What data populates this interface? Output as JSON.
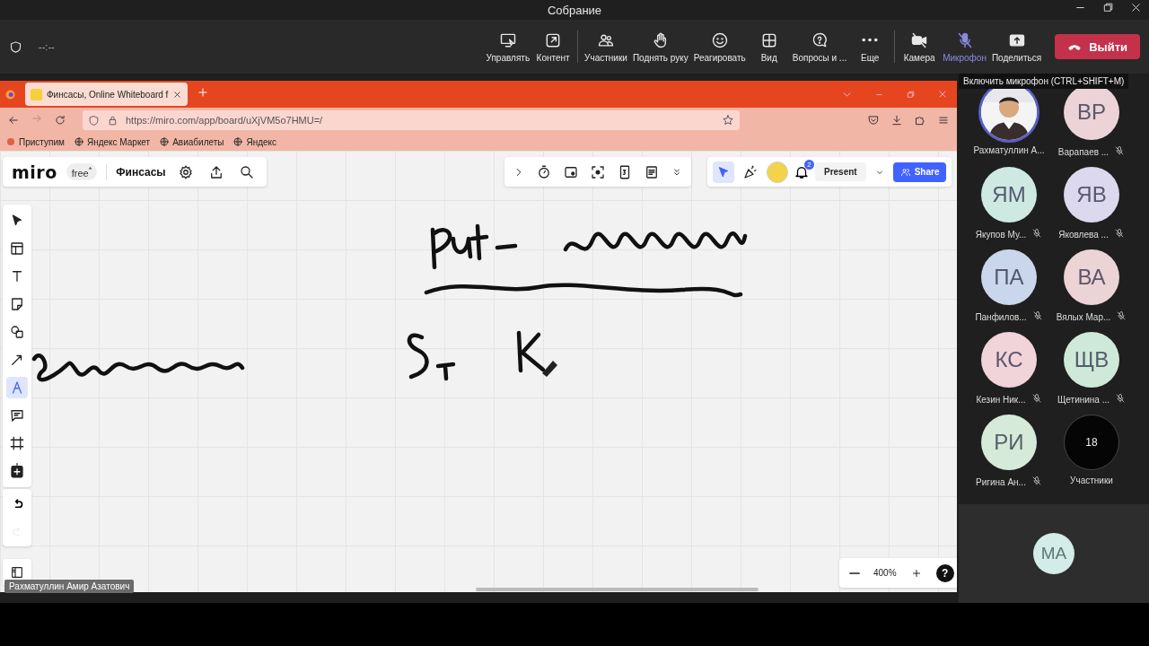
{
  "window": {
    "title": "Собрание"
  },
  "meeting_bar": {
    "timer": "--:--",
    "buttons": [
      {
        "label": "Управлять",
        "off": false
      },
      {
        "label": "Контент",
        "off": false
      },
      {
        "label": "Участники",
        "off": false
      },
      {
        "label": "Поднять руку",
        "off": false
      },
      {
        "label": "Реагировать",
        "off": false
      },
      {
        "label": "Вид",
        "off": false
      },
      {
        "label": "Вопросы и ...",
        "off": false
      },
      {
        "label": "Еще",
        "off": false
      },
      {
        "label": "Камера",
        "off": true
      },
      {
        "label": "Микрофон",
        "off": true
      },
      {
        "label": "Поделиться",
        "off": false
      }
    ],
    "leave": {
      "label": "Выйти"
    }
  },
  "tooltip": {
    "text": "Включить микрофон (CTRL+SHIFT+M)"
  },
  "browser": {
    "tab": {
      "title": "Финсасы, Online Whiteboard f",
      "selected": true
    },
    "url": "https://miro.com/app/board/uXjVM5o7HMU=/",
    "bookmarks": [
      "Приступим",
      "Яндекс Маркет",
      "Авиабилеты",
      "Яндекс"
    ]
  },
  "miro": {
    "logo": "miro",
    "plan": "free$^{*}$",
    "board_name": "Финсасы",
    "notification_count": "2",
    "present": "Present",
    "share": "Share",
    "zoom": "400%",
    "help": "?",
    "tools": [
      {
        "selected": false
      },
      {
        "selected": false
      },
      {
        "selected": false
      },
      {
        "selected": false
      },
      {
        "selected": false
      },
      {
        "selected": false
      },
      {
        "selected": true
      },
      {
        "selected": false
      },
      {
        "selected": false
      },
      {
        "selected": false
      }
    ],
    "history": [
      {
        "disabled": false
      },
      {
        "disabled": true
      }
    ]
  },
  "presenter_label": "Рахматуллин Амир Азатович",
  "participants": [
    {
      "name": "Рахматуллин А...",
      "muted": false,
      "highlighted": true
    },
    {
      "kind": "initials",
      "initials": "ВР",
      "name": "Варапаев ...",
      "muted": true,
      "highlighted": false,
      "color": "#ecd3d8"
    },
    {
      "kind": "initials",
      "initials": "ЯМ",
      "name": "Якупов Му...",
      "muted": true,
      "highlighted": false,
      "color": "#cde9e2"
    },
    {
      "kind": "initials",
      "initials": "ЯВ",
      "name": "Яковлева ...",
      "muted": true,
      "highlighted": false,
      "color": "#dcd9ee"
    },
    {
      "kind": "initials",
      "initials": "ПА",
      "name": "Панфилов...",
      "muted": true,
      "highlighted": false,
      "color": "#c9d6ec"
    },
    {
      "kind": "initials",
      "initials": "ВА",
      "name": "Вялых Мар...",
      "muted": true,
      "highlighted": false,
      "color": "#ecd3d6"
    },
    {
      "kind": "initials",
      "initials": "КС",
      "name": "Кезин Ник...",
      "muted": true,
      "highlighted": false,
      "color": "#f0d4da"
    },
    {
      "kind": "initials",
      "initials": "ЩВ",
      "name": "Щетинина ...",
      "muted": true,
      "highlighted": false,
      "color": "#cfe9d9"
    },
    {
      "kind": "initials",
      "initials": "РИ",
      "name": "Ригина Ан...",
      "muted": true,
      "highlighted": false,
      "color": "#d5ead8"
    },
    {
      "kind": "count",
      "count": "18",
      "name": "Участники"
    }
  ],
  "self_view": {
    "initials": "МА",
    "color": "#d3ece8"
  }
}
